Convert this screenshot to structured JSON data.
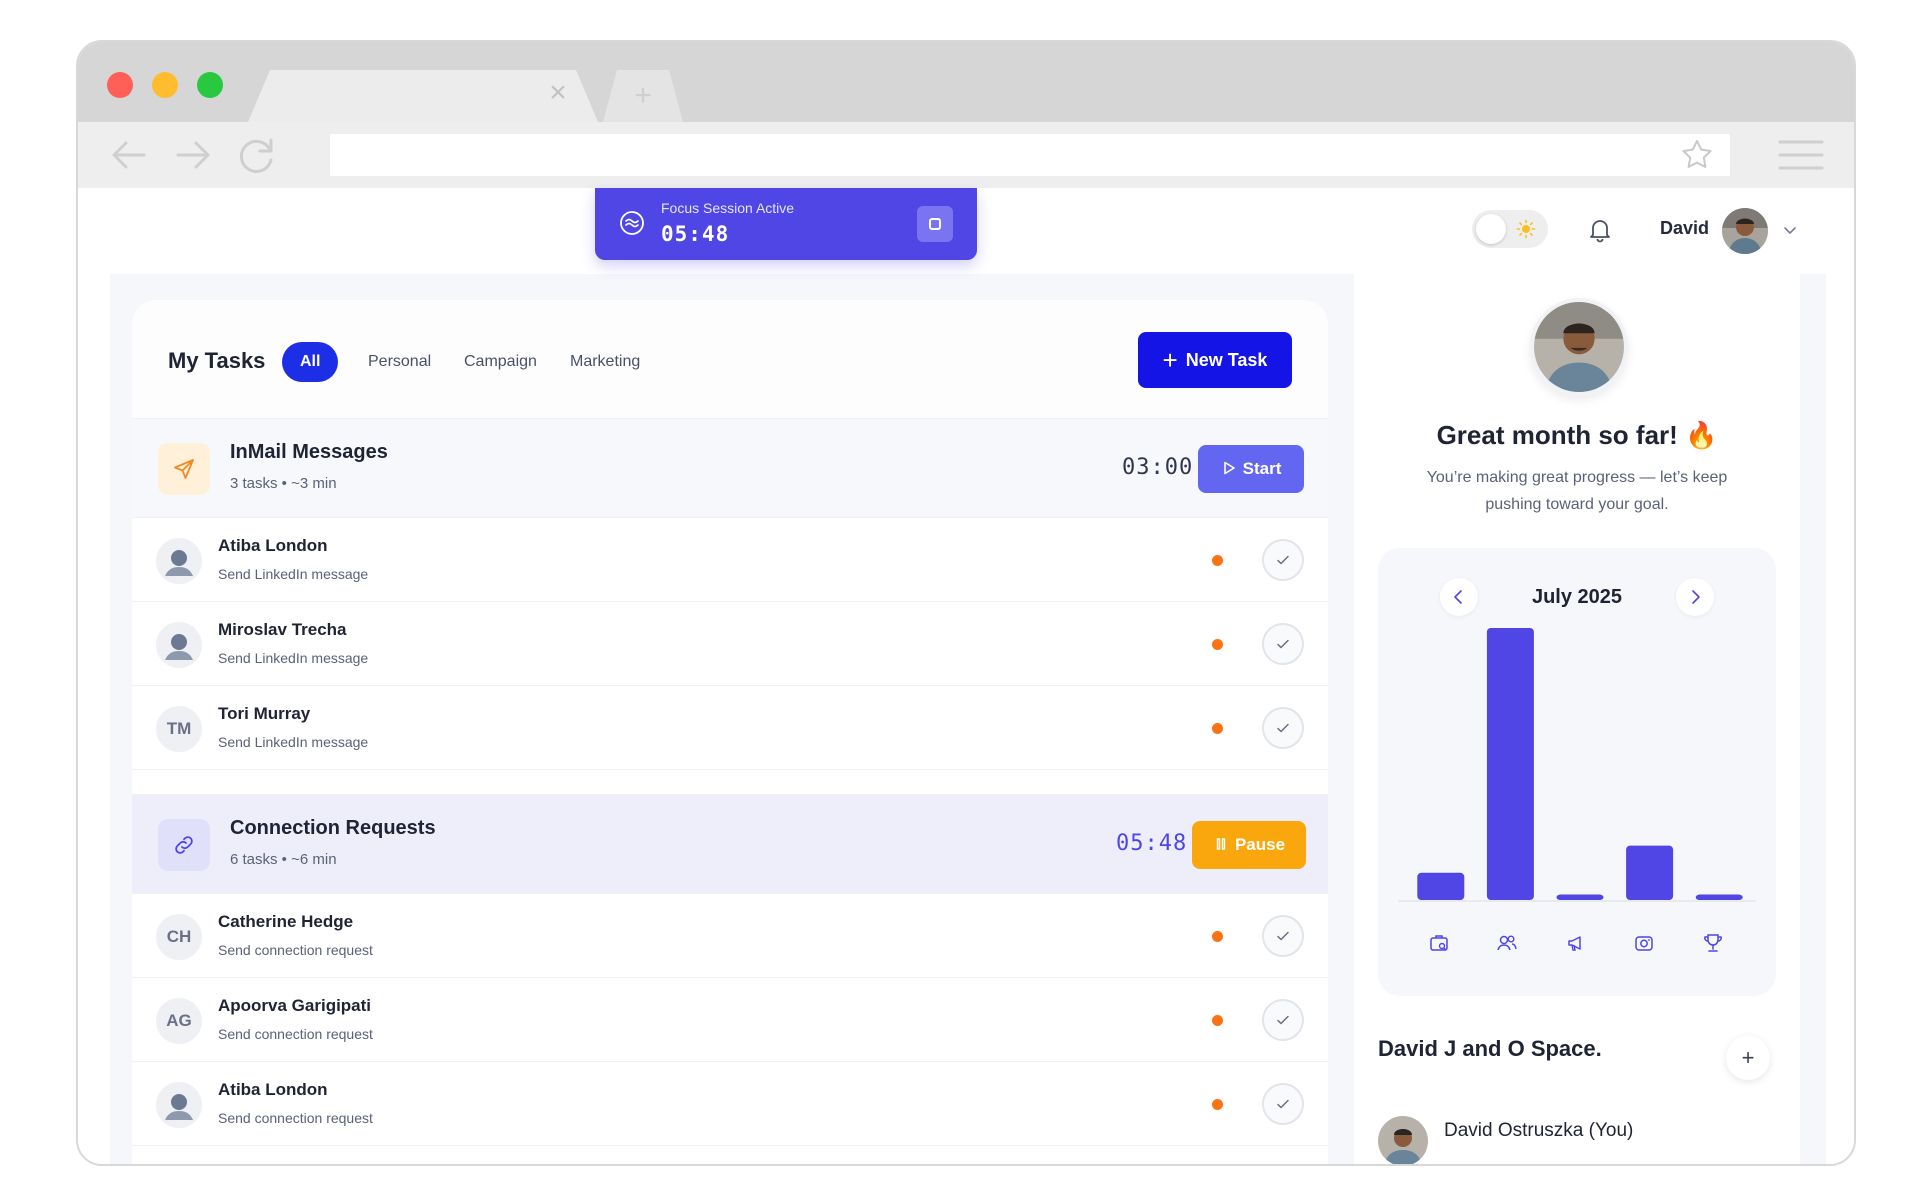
{
  "browser": {
    "url": "",
    "tab_title": ""
  },
  "focus": {
    "label": "Focus Session Active",
    "time": "05:48"
  },
  "header": {
    "user_name": "David"
  },
  "tasks": {
    "title": "My Tasks",
    "filters": [
      "All",
      "Personal",
      "Campaign",
      "Marketing"
    ],
    "active_filter": "All",
    "new_task_label": "New Task",
    "groups": [
      {
        "title": "InMail Messages",
        "meta": "3 tasks • ~3 min",
        "timer": "03:00",
        "action": "Start",
        "rows": [
          {
            "name": "Atiba London",
            "action": "Send LinkedIn message",
            "initials": ""
          },
          {
            "name": "Miroslav Trecha",
            "action": "Send LinkedIn message",
            "initials": ""
          },
          {
            "name": "Tori Murray",
            "action": "Send LinkedIn message",
            "initials": "TM"
          }
        ]
      },
      {
        "title": "Connection Requests",
        "meta": "6 tasks • ~6 min",
        "timer": "05:48",
        "action": "Pause",
        "rows": [
          {
            "name": "Catherine Hedge",
            "action": "Send connection request",
            "initials": "CH"
          },
          {
            "name": "Apoorva Garigipati",
            "action": "Send connection request",
            "initials": "AG"
          },
          {
            "name": "Atiba London",
            "action": "Send connection request",
            "initials": ""
          }
        ]
      }
    ]
  },
  "side": {
    "title": "Great month so far! 🔥",
    "subtitle": "You’re making great progress — let’s keep pushing toward your goal.",
    "month": "July 2025",
    "category_icons": [
      "briefcase-search-icon",
      "users-icon",
      "megaphone-icon",
      "camera-icon",
      "trophy-icon"
    ],
    "space_title": "David J and O Space.",
    "members": [
      {
        "name": "David Ostruszka (You)"
      }
    ]
  },
  "chart_data": {
    "type": "bar",
    "categories": [
      "briefcase-search-icon",
      "users-icon",
      "megaphone-icon",
      "camera-icon",
      "trophy-icon"
    ],
    "values": [
      10,
      100,
      2,
      20,
      2
    ],
    "ylim": [
      0,
      100
    ]
  },
  "colors": {
    "accent": "#4f46e5",
    "primary_button": "#1414e6",
    "pause": "#f9a70c",
    "priority_dot": "#fb7213"
  }
}
